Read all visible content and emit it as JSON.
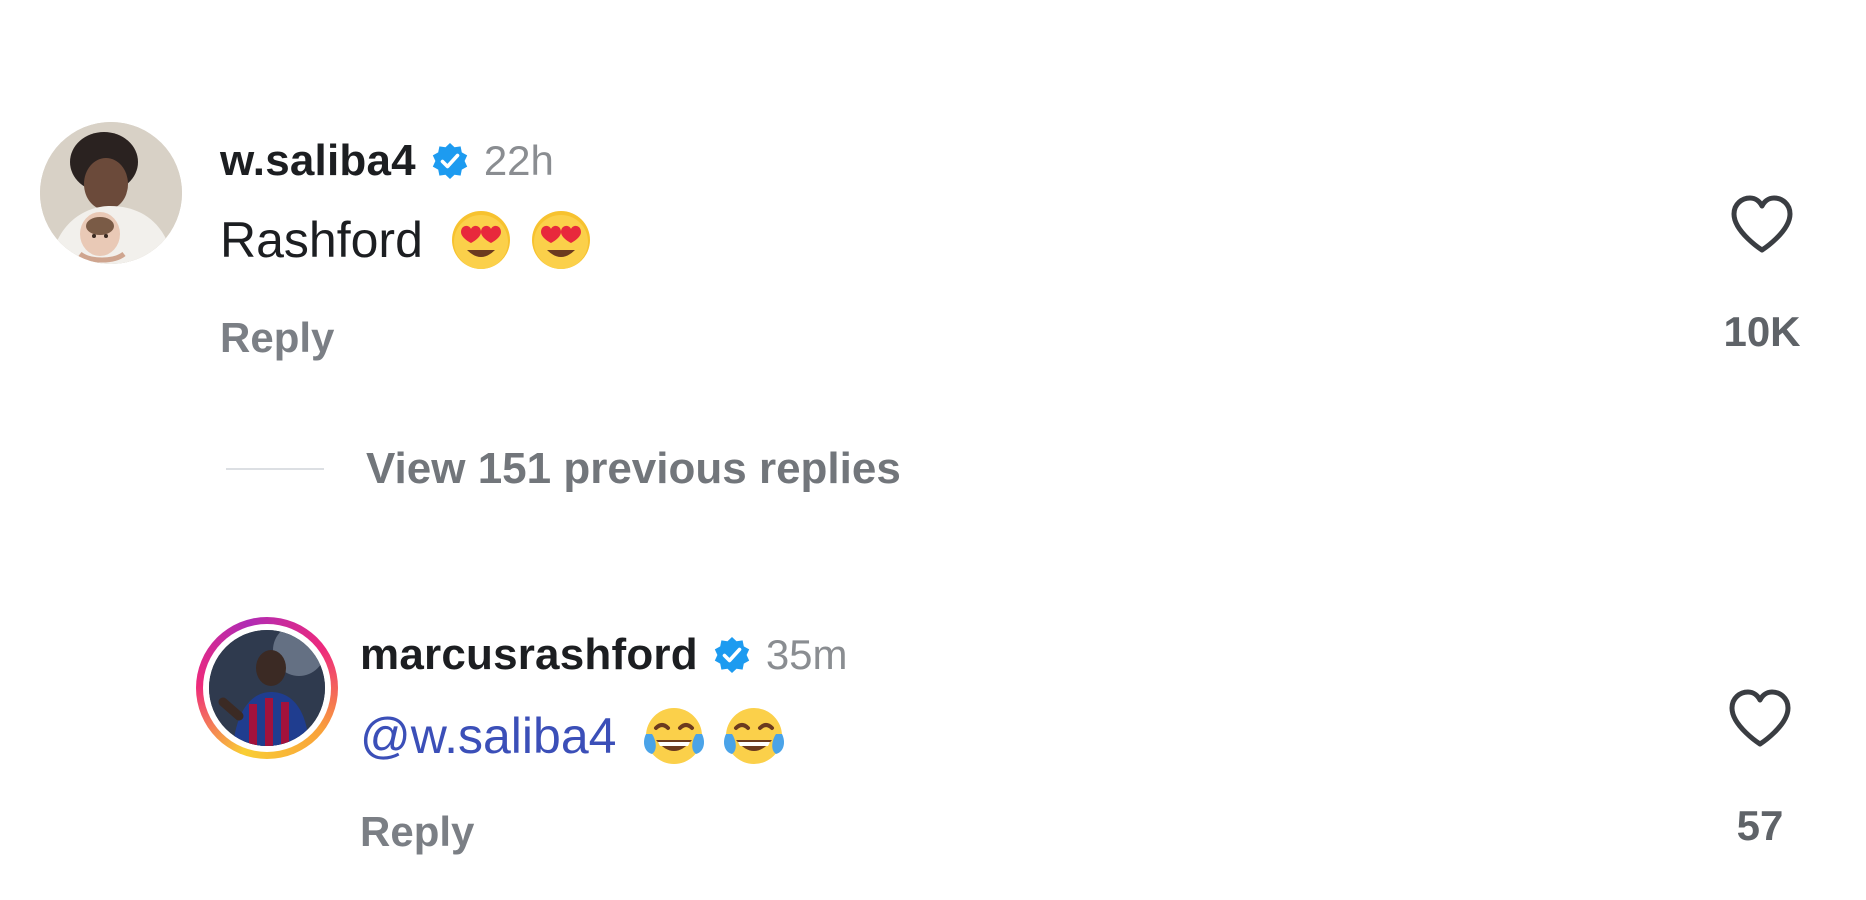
{
  "comments": [
    {
      "username": "w.saliba4",
      "verified": true,
      "time": "22h",
      "text": "Rashford",
      "emojis": [
        "heart-eyes",
        "heart-eyes"
      ],
      "reply_label": "Reply",
      "likes": "10K"
    },
    {
      "username": "marcusrashford",
      "verified": true,
      "time": "35m",
      "mention": "@w.saliba4",
      "emojis": [
        "tears-of-joy",
        "tears-of-joy"
      ],
      "reply_label": "Reply",
      "likes": "57"
    }
  ],
  "thread": {
    "view_previous_label": "View 151 previous replies"
  },
  "colors": {
    "verified_badge": "#1d9bf0",
    "mention": "#3b4fb8",
    "secondary_text": "#8a8d91",
    "story_ring": [
      "#f9ce34",
      "#ee2a7b",
      "#b02bb4"
    ]
  }
}
